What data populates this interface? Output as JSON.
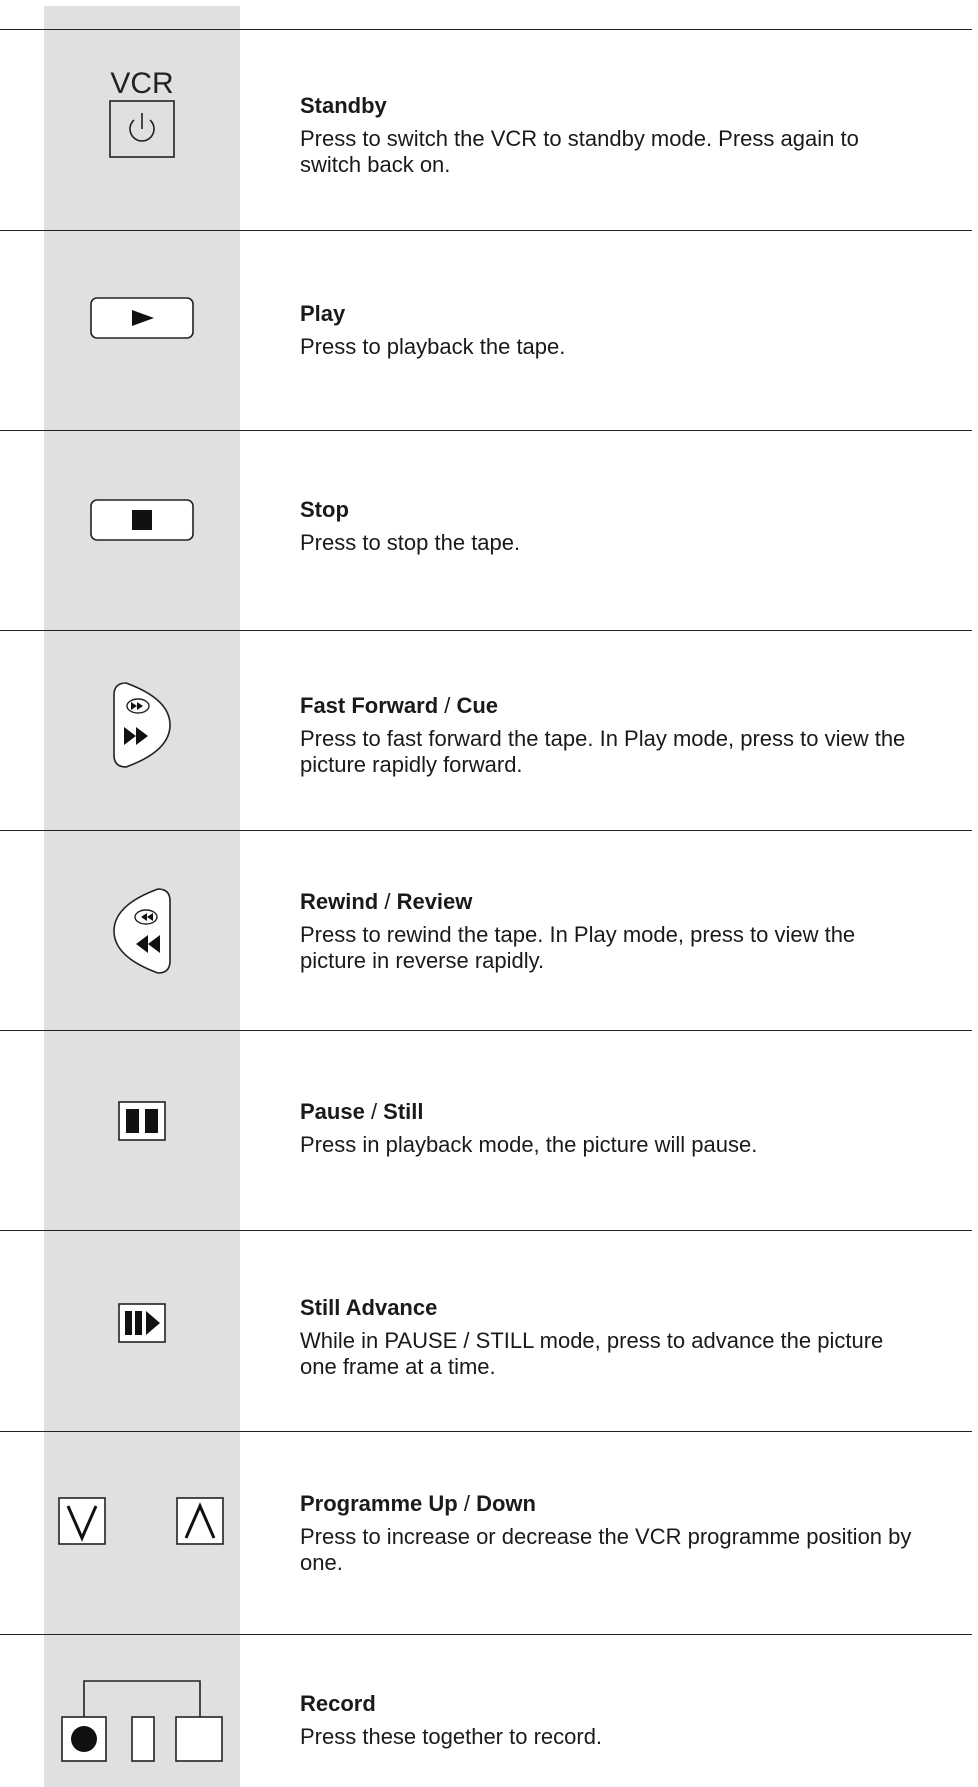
{
  "vcr_label": "VCR",
  "entries": [
    {
      "icon": "power-icon",
      "title": "Standby",
      "title2": "",
      "body": "Press to switch the VCR to standby mode. Press again to switch back on."
    },
    {
      "icon": "play-icon",
      "title": "Play",
      "title2": "",
      "body": "Press to playback the tape."
    },
    {
      "icon": "stop-icon",
      "title": "Stop",
      "title2": "",
      "body": "Press to stop the tape."
    },
    {
      "icon": "fast-forward-icon",
      "title": "Fast Forward",
      "title2": "Cue",
      "body": "Press to fast forward the tape. In Play mode, press to view the picture rapidly forward."
    },
    {
      "icon": "rewind-icon",
      "title": "Rewind",
      "title2": "Review",
      "body": "Press to rewind the tape. In Play mode, press to view the picture in reverse rapidly."
    },
    {
      "icon": "pause-icon",
      "title": "Pause",
      "title2": "Still",
      "body": "Press in playback mode, the picture will pause."
    },
    {
      "icon": "still-advance-icon",
      "title": "Still Advance",
      "title2": "",
      "body": "While in PAUSE / STILL mode, press to advance the picture one frame at a time."
    },
    {
      "icon": "programme-up-down-icon",
      "title": "Programme Up",
      "title2": "Down",
      "body": "Press to increase or decrease the VCR programme position by one."
    },
    {
      "icon": "record-icon",
      "title": "Record",
      "title2": "",
      "body": "Press these together to record."
    }
  ],
  "separator": " / "
}
